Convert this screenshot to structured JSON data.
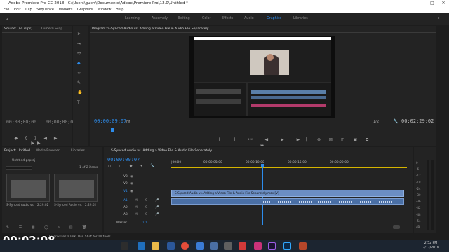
{
  "window": {
    "title": "Adobe Premiere Pro CC 2018 - C:\\Users\\guerr\\Documents\\Adobe\\Premiere Pro\\12.0\\Untitled *"
  },
  "menu": [
    "File",
    "Edit",
    "Clip",
    "Sequence",
    "Markers",
    "Graphics",
    "Window",
    "Help"
  ],
  "workspaces": [
    {
      "label": "Learning"
    },
    {
      "label": "Assembly"
    },
    {
      "label": "Editing"
    },
    {
      "label": "Color"
    },
    {
      "label": "Effects"
    },
    {
      "label": "Audio"
    },
    {
      "label": "Graphics",
      "active": true
    },
    {
      "label": "Libraries"
    }
  ],
  "source": {
    "tab": "Source: (no clips)",
    "tab2": "Lumetri Scop",
    "timecode": "00;00;00;00",
    "timecode_right": "00;00;00;00"
  },
  "program": {
    "tab": "Program: S-Synced Audio vs. Adding a Video File & Audio File Separately",
    "timecode": "00:00:09:07",
    "fit": "Fit",
    "fraction": "1/2",
    "duration": "00:02:29:02"
  },
  "project": {
    "tabs": [
      "Project: Untitled",
      "Media Browser",
      "Libraries"
    ],
    "file": "Untitled.prproj",
    "items_count": "1 of 2 items",
    "items": [
      {
        "name": "S-Synced Audio vs.",
        "duration": "2:29:02"
      },
      {
        "name": "S-Synced Audio vs.",
        "duration": "2:29:02"
      }
    ]
  },
  "timeline": {
    "tab": "S-Synced Audio vs. Adding a Video File & Audio File Separately",
    "timecode": "00:00:09:07",
    "ruler": [
      "|00:00",
      "00:00:05:00",
      "00:00:10:00",
      "00:00:15:00",
      "00:00:20:00"
    ],
    "tracks": [
      "V3",
      "V2",
      "V1",
      "A1",
      "A2",
      "A3"
    ],
    "clip_label": "S-Synced Audio vs. Adding a Video File & Audio File Separately.mov [V]",
    "master": "Master",
    "master_value": "0.0"
  },
  "meters": [
    "0",
    "-6",
    "-12",
    "-18",
    "-24",
    "-30",
    "-36",
    "-42",
    "-48",
    "-54",
    "dB"
  ],
  "overlay": {
    "timecode": "00:02:08",
    "status": "Overwrites a link. Use Shift for all tools."
  },
  "taskbar": {
    "time": "2:52 PM",
    "date": "3/13/2019"
  }
}
